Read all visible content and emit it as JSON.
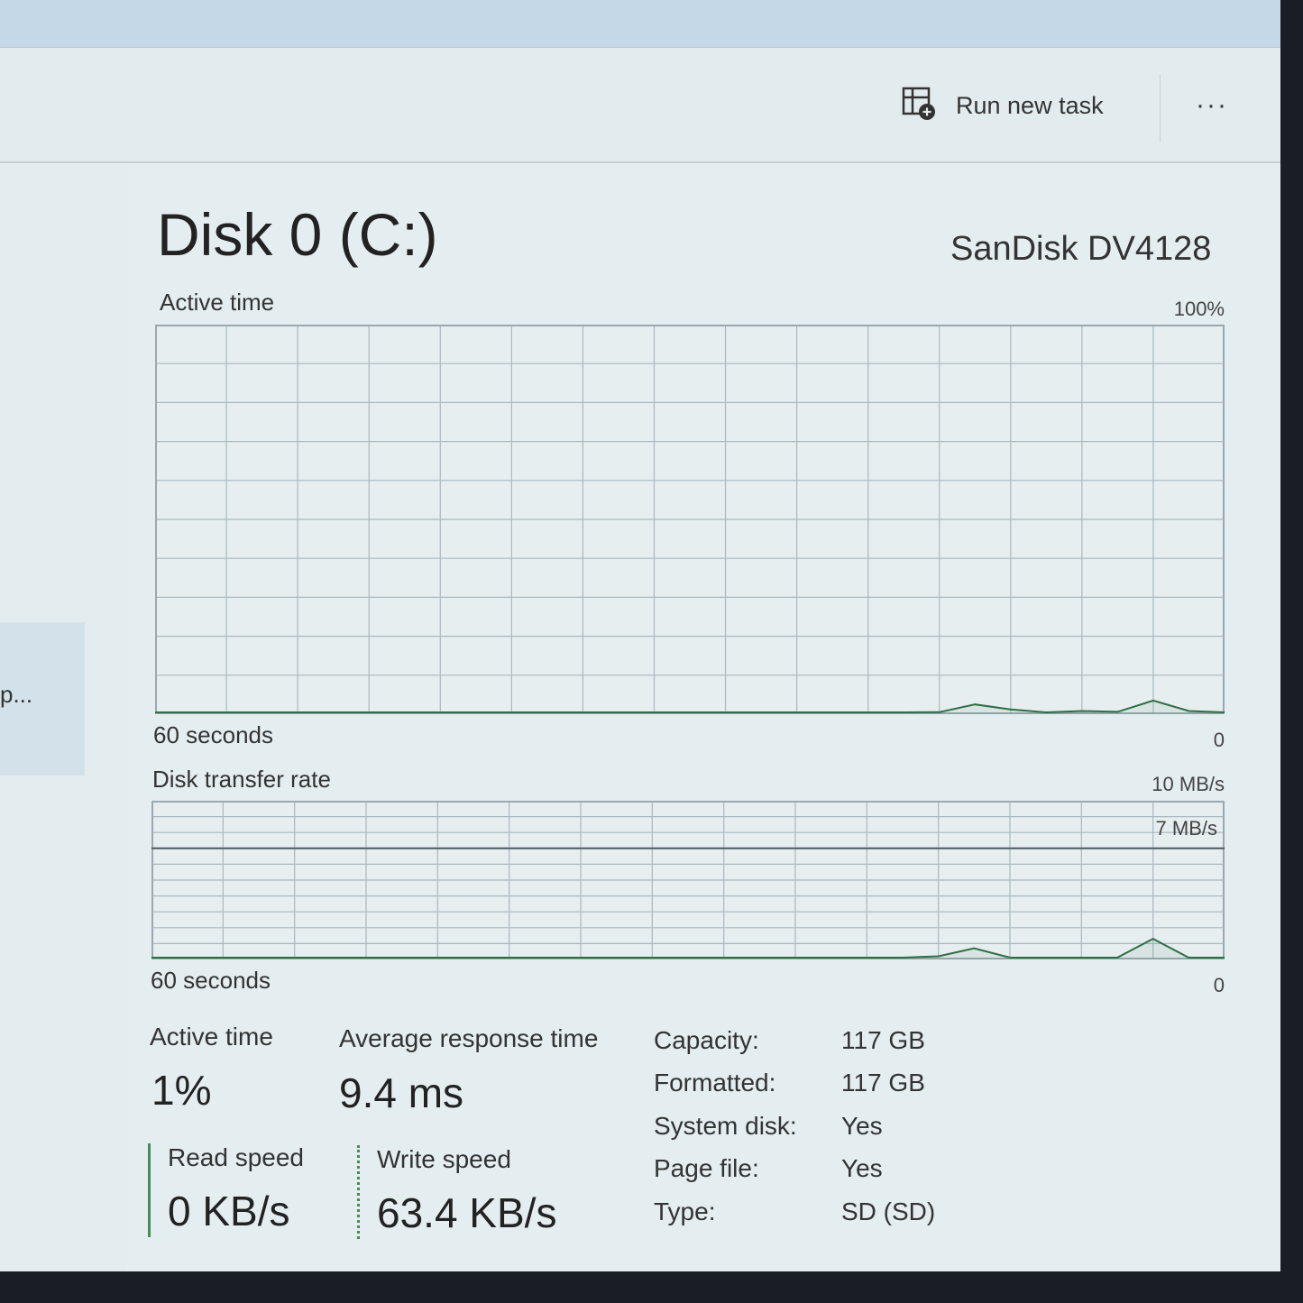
{
  "toolbar": {
    "run_new_task": "Run new task",
    "more": "···",
    "run_icon": "run-task-icon"
  },
  "left_pane": {
    "truncated_label": "p..."
  },
  "disk": {
    "title": "Disk 0 (C:)",
    "model": "SanDisk DV4128"
  },
  "chart_data": [
    {
      "type": "line",
      "title": "Active time",
      "xlabel": "60 seconds",
      "ymax_label": "100%",
      "ymin_label": "0",
      "ylim": [
        0,
        100
      ],
      "grid": true,
      "x": [
        0,
        2,
        4,
        6,
        8,
        10,
        12,
        14,
        16,
        18,
        20,
        22,
        24,
        26,
        28,
        30,
        32,
        34,
        36,
        38,
        40,
        42,
        44,
        46,
        48,
        50,
        52,
        54,
        56,
        58,
        60
      ],
      "series": [
        {
          "values": [
            0,
            0,
            0,
            0,
            0,
            0,
            0,
            0,
            0,
            0,
            0,
            0,
            0,
            0,
            0,
            0,
            0,
            0,
            0,
            0,
            0,
            0,
            0.5,
            2.5,
            1.2,
            0.3,
            0.8,
            0.6,
            3.5,
            0.8,
            0.2
          ]
        }
      ],
      "colors": {
        "line": "#2f6e44",
        "grid": "#a9b9bf",
        "border": "#9aa9af"
      }
    },
    {
      "type": "line",
      "title": "Disk transfer rate",
      "xlabel": "60 seconds",
      "ymax_label": "10 MB/s",
      "ref_label": "7 MB/s",
      "ymin_label": "0",
      "ylim": [
        0,
        10
      ],
      "ref_value": 7,
      "grid": true,
      "x": [
        0,
        2,
        4,
        6,
        8,
        10,
        12,
        14,
        16,
        18,
        20,
        22,
        24,
        26,
        28,
        30,
        32,
        34,
        36,
        38,
        40,
        42,
        44,
        46,
        48,
        50,
        52,
        54,
        56,
        58,
        60
      ],
      "series": [
        {
          "values": [
            0,
            0,
            0,
            0,
            0,
            0,
            0,
            0,
            0,
            0,
            0,
            0,
            0,
            0,
            0,
            0,
            0,
            0,
            0,
            0,
            0,
            0,
            0.2,
            0.7,
            0.1,
            0,
            0,
            0.1,
            1.3,
            0,
            0
          ]
        }
      ],
      "colors": {
        "line": "#2f6e44",
        "grid": "#a9b9bf",
        "border": "#9aa9af"
      }
    }
  ],
  "stats": {
    "active_time_label": "Active time",
    "active_time_value": "1%",
    "avg_response_label": "Average response time",
    "avg_response_value": "9.4 ms",
    "read_speed_label": "Read speed",
    "read_speed_value": "0 KB/s",
    "write_speed_label": "Write speed",
    "write_speed_value": "63.4 KB/s"
  },
  "properties": [
    {
      "label": "Capacity:",
      "value": "117 GB"
    },
    {
      "label": "Formatted:",
      "value": "117 GB"
    },
    {
      "label": "System disk:",
      "value": "Yes"
    },
    {
      "label": "Page file:",
      "value": "Yes"
    },
    {
      "label": "Type:",
      "value": "SD (SD)"
    }
  ]
}
